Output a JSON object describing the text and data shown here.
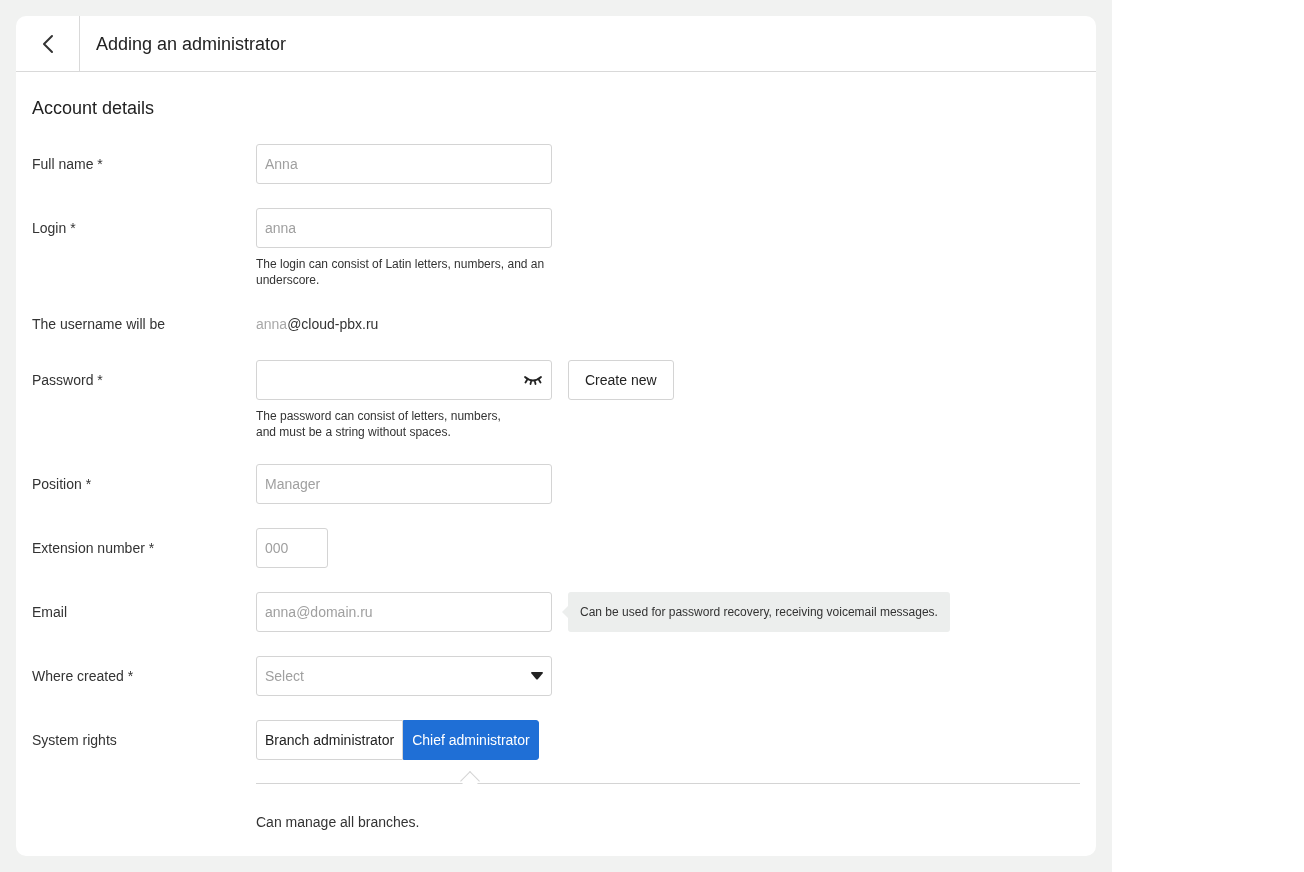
{
  "header": {
    "title": "Adding an administrator"
  },
  "section": {
    "title": "Account details"
  },
  "fields": [
    {
      "kind": "text",
      "label": "Full name *",
      "placeholder": "Anna"
    },
    {
      "kind": "text",
      "label": "Login *",
      "placeholder": "anna",
      "hint": "The login can consist of Latin letters, numbers, and an underscore."
    },
    {
      "kind": "username",
      "label": "The username will be",
      "prefix": "anna",
      "suffix": "@cloud-pbx.ru"
    },
    {
      "kind": "password",
      "label": "Password *",
      "button": "Create new",
      "hint_lines": [
        "The password can consist of letters, numbers,",
        "and must be a string without spaces."
      ]
    },
    {
      "kind": "text",
      "label": "Position *",
      "placeholder": "Manager"
    },
    {
      "kind": "short_text",
      "label": "Extension number *",
      "placeholder": "000"
    },
    {
      "kind": "text",
      "label": "Email",
      "placeholder": "anna@domain.ru",
      "tooltip": "Can be used for password recovery, receiving voicemail messages."
    },
    {
      "kind": "select",
      "label": "Where created *",
      "placeholder": "Select"
    },
    {
      "kind": "segmented",
      "label": "System rights",
      "options": [
        {
          "label": "Branch administrator",
          "selected": false
        },
        {
          "label": "Chief administrator",
          "selected": true
        }
      ],
      "description": "Can manage all branches."
    }
  ]
}
